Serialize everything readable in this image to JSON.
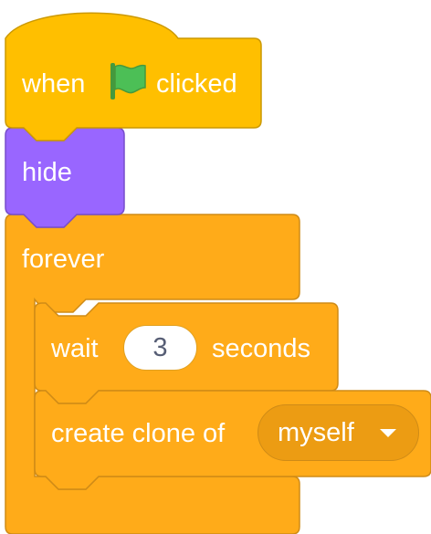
{
  "script": {
    "hat": {
      "label_when": "when",
      "label_clicked": "clicked",
      "icon": "green-flag-icon"
    },
    "hide": {
      "label": "hide"
    },
    "forever": {
      "label": "forever"
    },
    "wait": {
      "label_wait": "wait",
      "seconds_value": "3",
      "label_seconds": "seconds"
    },
    "create_clone": {
      "label": "create clone of",
      "target_value": "myself"
    }
  },
  "colors": {
    "events": "#ffbf00",
    "looks": "#9966ff",
    "control": "#ffab19",
    "control_menu": "#ec9c13",
    "flag_green": "#4cbf56"
  }
}
